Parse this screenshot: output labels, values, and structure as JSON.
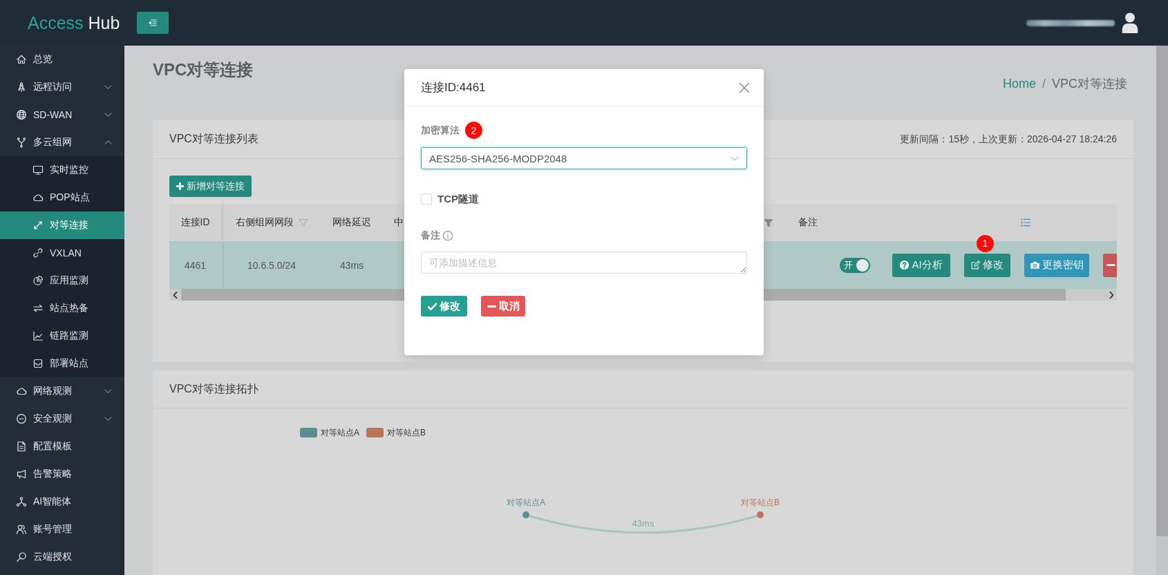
{
  "header": {
    "logo_accent": "Access",
    "logo_rest": "Hub"
  },
  "sidebar": {
    "items": [
      {
        "label": "总览",
        "selected": false
      },
      {
        "label": "远程访问",
        "selected": false,
        "expanded": false
      },
      {
        "label": "SD-WAN",
        "selected": false,
        "expanded": false
      },
      {
        "label": "多云组网",
        "selected": false,
        "expanded": true,
        "children": [
          {
            "label": "实时监控",
            "selected": false
          },
          {
            "label": "POP站点",
            "selected": false
          },
          {
            "label": "对等连接",
            "selected": true
          },
          {
            "label": "VXLAN",
            "selected": false
          },
          {
            "label": "应用监测",
            "selected": false
          },
          {
            "label": "站点热备",
            "selected": false
          },
          {
            "label": "链路监测",
            "selected": false
          },
          {
            "label": "部署站点",
            "selected": false
          }
        ]
      },
      {
        "label": "网络观测",
        "selected": false,
        "expanded": false
      },
      {
        "label": "安全观测",
        "selected": false,
        "expanded": false
      },
      {
        "label": "配置模板",
        "selected": false
      },
      {
        "label": "告警策略",
        "selected": false
      },
      {
        "label": "AI智能体",
        "selected": false
      },
      {
        "label": "账号管理",
        "selected": false
      },
      {
        "label": "云端授权",
        "selected": false
      }
    ]
  },
  "page": {
    "title": "VPC对等连接",
    "breadcrumb": [
      {
        "label": "Home",
        "current": false
      },
      {
        "label": "VPC对等连接",
        "current": true
      }
    ],
    "breadcrumb_separator": "/"
  },
  "list_card": {
    "title": "VPC对等连接列表",
    "update_info": "更新间隔：15秒，上次更新：2026-04-27 18:24:26",
    "add_button": "新增对等连接",
    "table": {
      "columns": [
        {
          "label": "连接ID"
        },
        {
          "label": "右侧组网网段",
          "filtered": false
        },
        {
          "label": "网络延迟"
        },
        {
          "label": "中"
        },
        {
          "filtered": true
        },
        {
          "label": "备注"
        },
        {
          "kind": "settings"
        }
      ],
      "rows": [
        {
          "selected": true,
          "cells": [
            "4461",
            "10.6.5.0/24",
            "43ms"
          ],
          "switch": {
            "label": "开",
            "on": true
          },
          "actions": [
            {
              "kind": "ai",
              "label": "AI分析"
            },
            {
              "kind": "edit",
              "label": "修改",
              "badge": "1"
            },
            {
              "kind": "key",
              "label": "更换密钥"
            },
            {
              "kind": "delete"
            }
          ]
        }
      ]
    }
  },
  "topology_card": {
    "title": "VPC对等连接拓扑",
    "legend": [
      {
        "label": "对等站点A",
        "color": "#5b8f94"
      },
      {
        "label": "对等站点B",
        "color": "#b97459"
      }
    ],
    "nodes": [
      {
        "label": "对等站点A",
        "color": "#5b8f94"
      },
      {
        "label": "对等站点B",
        "color": "#b97459"
      }
    ],
    "links": [
      {
        "label": "43ms"
      }
    ]
  },
  "modal": {
    "title": "连接ID:4461",
    "fields": [
      {
        "kind": "select",
        "label": "加密算法",
        "badge": "2",
        "value": "AES256-SHA256-MODP2048",
        "focused": true
      },
      {
        "kind": "checkbox",
        "label": "TCP隧道",
        "checked": false
      },
      {
        "kind": "textarea",
        "label": "备注",
        "info": true,
        "placeholder": "可添加描述信息"
      }
    ],
    "buttons": [
      {
        "kind": "confirm",
        "label": "修改"
      },
      {
        "kind": "cancel",
        "label": "取消"
      }
    ]
  }
}
